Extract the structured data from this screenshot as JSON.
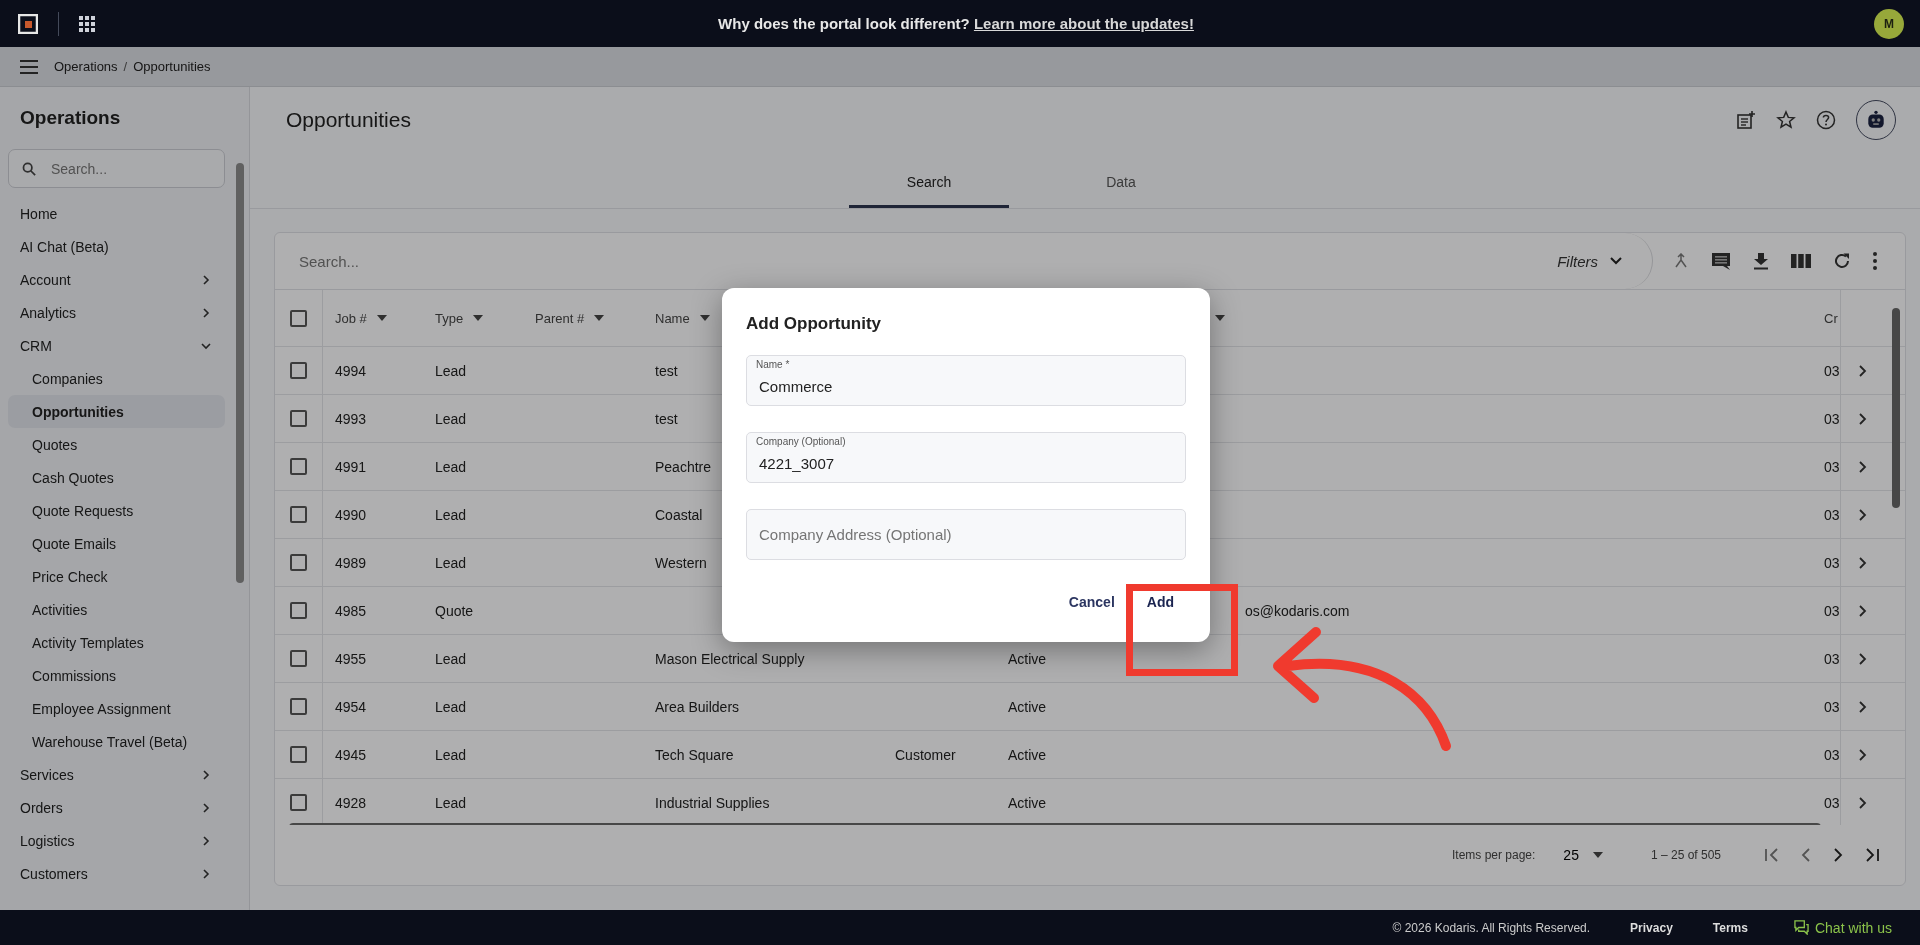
{
  "top_bar": {
    "announcement": "Why does the portal look different?",
    "announcement_link": "Learn more about the updates!",
    "avatar": "M"
  },
  "breadcrumb": {
    "items": [
      "Operations",
      "Opportunities"
    ],
    "separator": "/"
  },
  "sidebar": {
    "title": "Operations",
    "search": {
      "placeholder": "Search..."
    },
    "items": [
      {
        "label": "Home",
        "selected": false
      },
      {
        "label": "AI Chat (Beta)",
        "selected": false
      },
      {
        "label": "Account",
        "selected": false,
        "expanded": false
      },
      {
        "label": "Analytics",
        "selected": false,
        "expanded": false
      },
      {
        "label": "CRM",
        "selected": false,
        "expanded": true,
        "children": [
          {
            "label": "Companies",
            "selected": false
          },
          {
            "label": "Opportunities",
            "selected": true
          },
          {
            "label": "Quotes",
            "selected": false
          },
          {
            "label": "Cash Quotes",
            "selected": false
          },
          {
            "label": "Quote Requests",
            "selected": false
          },
          {
            "label": "Quote Emails",
            "selected": false
          },
          {
            "label": "Price Check",
            "selected": false
          },
          {
            "label": "Activities",
            "selected": false
          },
          {
            "label": "Activity Templates",
            "selected": false
          },
          {
            "label": "Commissions",
            "selected": false
          },
          {
            "label": "Employee Assignment",
            "selected": false
          },
          {
            "label": "Warehouse Travel (Beta)",
            "selected": false
          }
        ]
      },
      {
        "label": "Services",
        "selected": false,
        "expanded": false
      },
      {
        "label": "Orders",
        "selected": false,
        "expanded": false
      },
      {
        "label": "Logistics",
        "selected": false,
        "expanded": false
      },
      {
        "label": "Customers",
        "selected": false,
        "expanded": false
      }
    ]
  },
  "page": {
    "title": "Opportunities",
    "tabs": [
      {
        "label": "Search",
        "selected": true
      },
      {
        "label": "Data",
        "selected": false
      }
    ]
  },
  "table": {
    "search": {
      "placeholder": "Search..."
    },
    "filters": "Filters",
    "select_all": {
      "checked": false
    },
    "columns": [
      {
        "label": "Job #",
        "sortable": true
      },
      {
        "label": "Type",
        "sortable": true
      },
      {
        "label": "Parent #",
        "sortable": true
      },
      {
        "label": "Name",
        "sortable": true
      },
      {},
      {
        "sortable": true
      },
      {},
      {
        "label": "Cr"
      }
    ],
    "rows": [
      {
        "selected": false,
        "cells": [
          "4994",
          "Lead",
          null,
          "test",
          null,
          null,
          null,
          "03"
        ]
      },
      {
        "selected": false,
        "cells": [
          "4993",
          "Lead",
          null,
          "test",
          null,
          null,
          null,
          "03"
        ]
      },
      {
        "selected": false,
        "cells": [
          "4991",
          "Lead",
          null,
          "Peachtre",
          null,
          null,
          null,
          "03"
        ]
      },
      {
        "selected": false,
        "cells": [
          "4990",
          "Lead",
          null,
          "Coastal",
          null,
          null,
          null,
          "03"
        ]
      },
      {
        "selected": false,
        "cells": [
          "4989",
          "Lead",
          null,
          "Western",
          null,
          null,
          null,
          "03"
        ]
      },
      {
        "selected": false,
        "cells": [
          "4985",
          "Quote",
          null,
          null,
          null,
          null,
          "os@kodaris.com",
          "03"
        ]
      },
      {
        "selected": false,
        "cells": [
          "4955",
          "Lead",
          null,
          "Mason Electrical Supply",
          null,
          "Active",
          null,
          "03"
        ]
      },
      {
        "selected": false,
        "cells": [
          "4954",
          "Lead",
          null,
          "Area Builders",
          null,
          "Active",
          null,
          "03"
        ]
      },
      {
        "selected": false,
        "cells": [
          "4945",
          "Lead",
          null,
          "Tech Square",
          "Customer",
          "Active",
          null,
          "03"
        ]
      },
      {
        "selected": false,
        "cells": [
          "4928",
          "Lead",
          null,
          "Industrial Supplies",
          null,
          "Active",
          null,
          "03"
        ]
      }
    ],
    "pagination": {
      "items_per_page_label": "Items per page:",
      "items_per_page": "25",
      "range": "1 – 25 of 505"
    }
  },
  "dialog": {
    "title": "Add Opportunity",
    "fields": [
      {
        "label": "Name *",
        "value": "Commerce"
      },
      {
        "label": "Company (Optional)",
        "value": "4221_3007"
      },
      {
        "placeholder": "Company Address (Optional)"
      }
    ],
    "buttons": [
      {
        "label": "Cancel",
        "kind": "secondary"
      },
      {
        "label": "Add",
        "kind": "primary"
      }
    ]
  },
  "footer": {
    "copyright": "© 2026 Kodaris. All Rights Reserved.",
    "links": [
      "Privacy",
      "Terms"
    ],
    "chat": "Chat with us"
  }
}
